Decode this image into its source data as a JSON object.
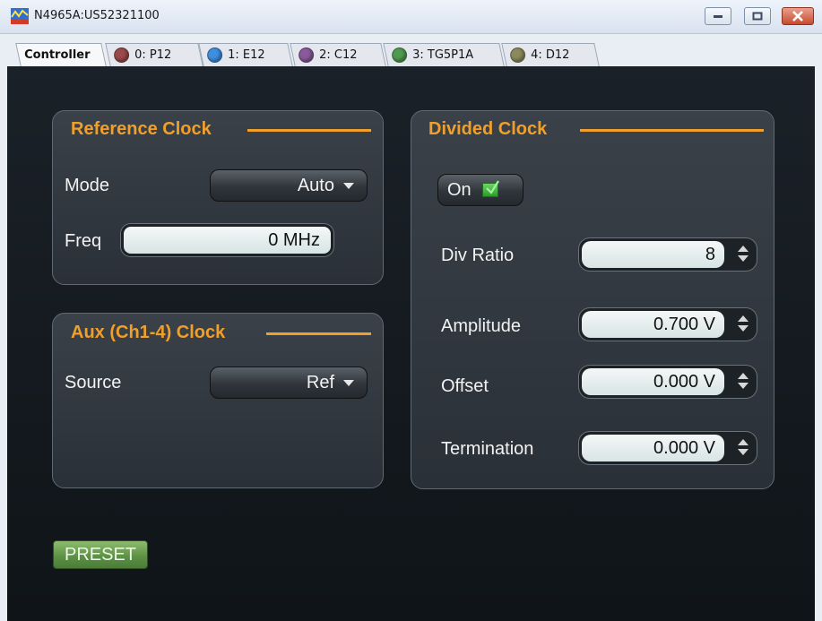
{
  "window": {
    "title": "N4965A:US52321100"
  },
  "tabs": [
    {
      "label": "Controller",
      "color": ""
    },
    {
      "label": "0: P12",
      "color": "#9a4a4a"
    },
    {
      "label": "1: E12",
      "color": "#3f8fe0"
    },
    {
      "label": "2: C12",
      "color": "#8a5a9c"
    },
    {
      "label": "3: TG5P1A",
      "color": "#4f9a4f"
    },
    {
      "label": "4: D12",
      "color": "#8c8a5c"
    }
  ],
  "reference_clock": {
    "title": "Reference Clock",
    "mode_label": "Mode",
    "mode_value": "Auto",
    "freq_label": "Freq",
    "freq_value": "0 MHz"
  },
  "aux_clock": {
    "title": "Aux (Ch1-4) Clock",
    "source_label": "Source",
    "source_value": "Ref"
  },
  "divided_clock": {
    "title": "Divided Clock",
    "toggle_label": "On",
    "div_ratio_label": "Div Ratio",
    "div_ratio_value": "8",
    "amplitude_label": "Amplitude",
    "amplitude_value": "0.700 V",
    "offset_label": "Offset",
    "offset_value": "0.000 V",
    "termination_label": "Termination",
    "termination_value": "0.000 V"
  },
  "preset_label": "PRESET"
}
